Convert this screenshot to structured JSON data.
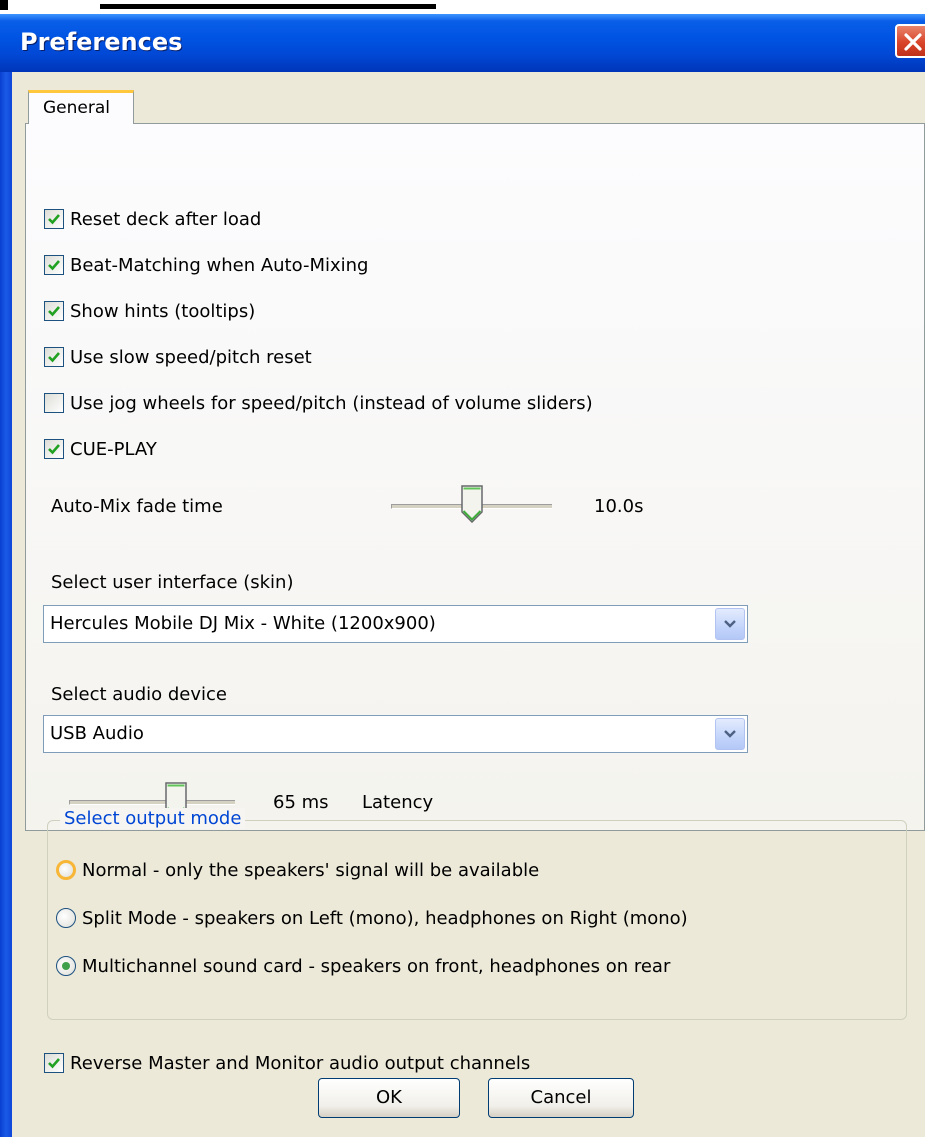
{
  "window": {
    "title": "Preferences"
  },
  "tabs": [
    {
      "label": "General"
    }
  ],
  "checkboxes": [
    {
      "label": "Reset deck after load",
      "checked": true
    },
    {
      "label": "Beat-Matching when Auto-Mixing",
      "checked": true
    },
    {
      "label": "Show hints (tooltips)",
      "checked": true
    },
    {
      "label": "Use slow speed/pitch reset",
      "checked": true
    },
    {
      "label": "Use jog wheels for speed/pitch (instead of volume sliders)",
      "checked": false
    },
    {
      "label": "CUE-PLAY",
      "checked": true
    }
  ],
  "automix": {
    "label": "Auto-Mix fade time",
    "value": "10.0s"
  },
  "skin": {
    "label": "Select user interface (skin)",
    "selected": "Hercules Mobile DJ Mix - White (1200x900)"
  },
  "audio": {
    "label": "Select audio device",
    "selected": "USB Audio"
  },
  "latency": {
    "value": "65 ms",
    "label": "Latency"
  },
  "output_mode": {
    "title": "Select output mode",
    "options": [
      {
        "label": "Normal - only the speakers' signal will be available",
        "selected": false
      },
      {
        "label": "Split Mode - speakers on Left (mono), headphones on Right (mono)",
        "selected": false
      },
      {
        "label": "Multichannel sound card - speakers on front, headphones on rear",
        "selected": true
      }
    ]
  },
  "reverse": {
    "label": "Reverse Master and Monitor audio output channels",
    "checked": true
  },
  "buttons": {
    "ok": "OK",
    "cancel": "Cancel"
  },
  "colors": {
    "titlebar": "#0054e3",
    "accent": "#21a121",
    "group_title": "#0046d5",
    "tab_highlight": "#ffc83c"
  }
}
